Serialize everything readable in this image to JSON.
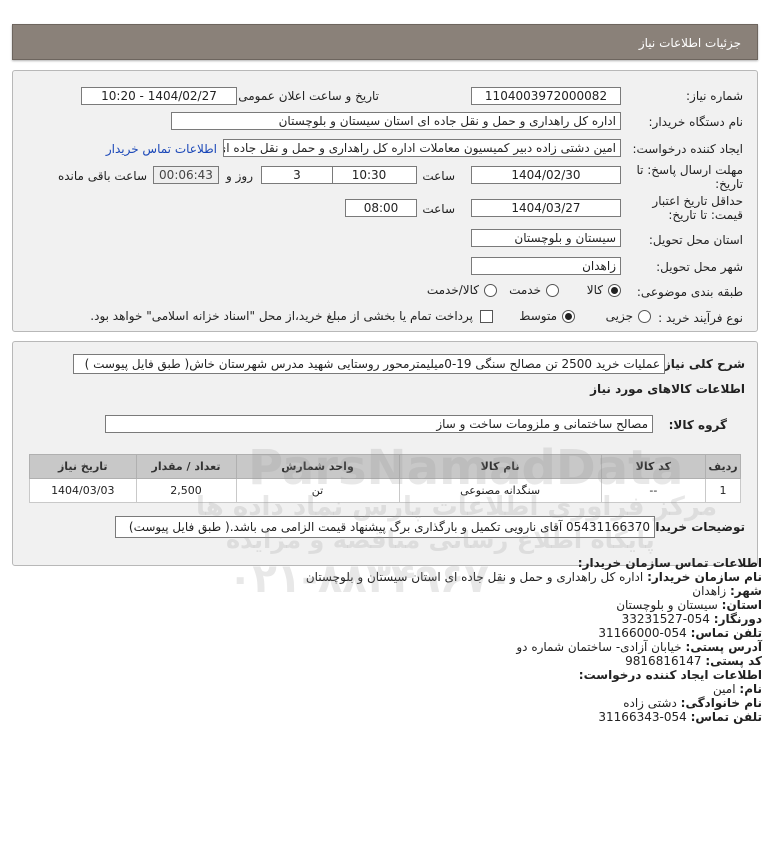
{
  "header": {
    "title": "جزئیات اطلاعات نیاز"
  },
  "form": {
    "need_number_label": "شماره نیاز:",
    "need_number": "1104003972000082",
    "announce_label": "تاریخ و ساعت اعلان عمومی:",
    "announce_value": "1404/02/27 - 10:20",
    "buyer_label": "نام دستگاه خریدار:",
    "buyer_value": "اداره کل راهداری و حمل و نقل جاده ای استان سیستان و بلوچستان",
    "creator_label": "ایجاد کننده درخواست:",
    "creator_value": "امین دشتی زاده دبیر کمیسیون معاملات اداره کل راهداری و حمل و نقل جاده ای",
    "contact_link": "اطلاعات تماس خریدار",
    "deadline_label": "مهلت ارسال پاسخ: تا تاریخ:",
    "deadline_date": "1404/02/30",
    "time_label": "ساعت",
    "deadline_time": "10:30",
    "days_value": "3",
    "days_label": "روز و",
    "remaining_value": "00:06:43",
    "remaining_label": "ساعت باقی مانده",
    "validity_label": "حداقل تاریخ اعتبار قیمت: تا تاریخ:",
    "validity_date": "1404/03/27",
    "validity_time": "08:00",
    "delivery_province_label": "استان محل تحویل:",
    "delivery_province": "سیستان و بلوچستان",
    "delivery_city_label": "شهر محل تحویل:",
    "delivery_city": "زاهدان",
    "category_label": "طبقه بندی موضوعی:",
    "category_options": [
      "کالا",
      "خدمت",
      "کالا/خدمت"
    ],
    "process_label": "نوع فرآیند خرید :",
    "process_options": [
      "جزیی",
      "متوسط"
    ],
    "payment_note": "پرداخت تمام یا بخشی از مبلغ خرید،از محل \"اسناد خزانه اسلامی\" خواهد بود."
  },
  "details": {
    "description_label": "شرح کلی نیاز:",
    "description_value": "عملیات خرید 2500 تن مصالح سنگی 19-0میلیمترمحور روستایی شهید مدرس شهرستان خاش( طبق فایل پیوست )",
    "goods_info_title": "اطلاعات کالاهای مورد نیاز",
    "goods_group_label": "گروه کالا:",
    "goods_group_value": "مصالح ساختمانی و ملزومات ساخت  و ساز",
    "table": {
      "headers": [
        "ردیف",
        "کد کالا",
        "نام کالا",
        "واحد شمارش",
        "تعداد / مقدار",
        "تاریخ نیاز"
      ],
      "rows": [
        [
          "1",
          "--",
          "سنگدانه مصنوعی",
          "تن",
          "2,500",
          "1404/03/03"
        ]
      ]
    },
    "buyer_notes_label": "توضیحات خریدار:",
    "buyer_notes_value": "05431166370 آقای نارویی تکمیل و بارگذاری برگ پیشنهاد قیمت الزامی می باشد.( طبق فایل پیوست)"
  },
  "contact": {
    "title": "اطلاعات تماس سازمان خریدار:",
    "org_label": "نام سازمان خریدار:",
    "org_value": "اداره کل راهداری و حمل و نقل جاده ای استان سیستان و بلوچستان",
    "city_label": "شهر:",
    "city_value": "زاهدان",
    "province_label": "استان:",
    "province_value": "سیستان و بلوچستان",
    "fax_label": "دورنگار:",
    "fax_value": "054-33231527",
    "phone_label": "تلفن تماس:",
    "phone_value": "054-31166000",
    "address_label": "آدرس پستی:",
    "address_value": "خیابان آزادی- ساختمان شماره دو",
    "postal_label": "کد پستی:",
    "postal_value": "9816816147",
    "creator_title": "اطلاعات ایجاد کننده درخواست:",
    "name_label": "نام:",
    "name_value": "امین",
    "family_label": "نام خانوادگی:",
    "family_value": "دشتی زاده",
    "creator_phone_label": "تلفن تماس:",
    "creator_phone_value": "054-31166343"
  },
  "watermark": {
    "brand": "ParsNamadData",
    "line1": "مرکز فراوری اطلاعات پارس نماد داده ها",
    "line2": "پایگاه اطلاع رسانی مناقصه و مزایده",
    "phone": "۰۲۱-۸۸۳۴۹۶۷۰"
  },
  "colors": {
    "header_bg": "#8a8179",
    "panel_bg": "#f1f1f1",
    "link": "#1a47b8"
  }
}
